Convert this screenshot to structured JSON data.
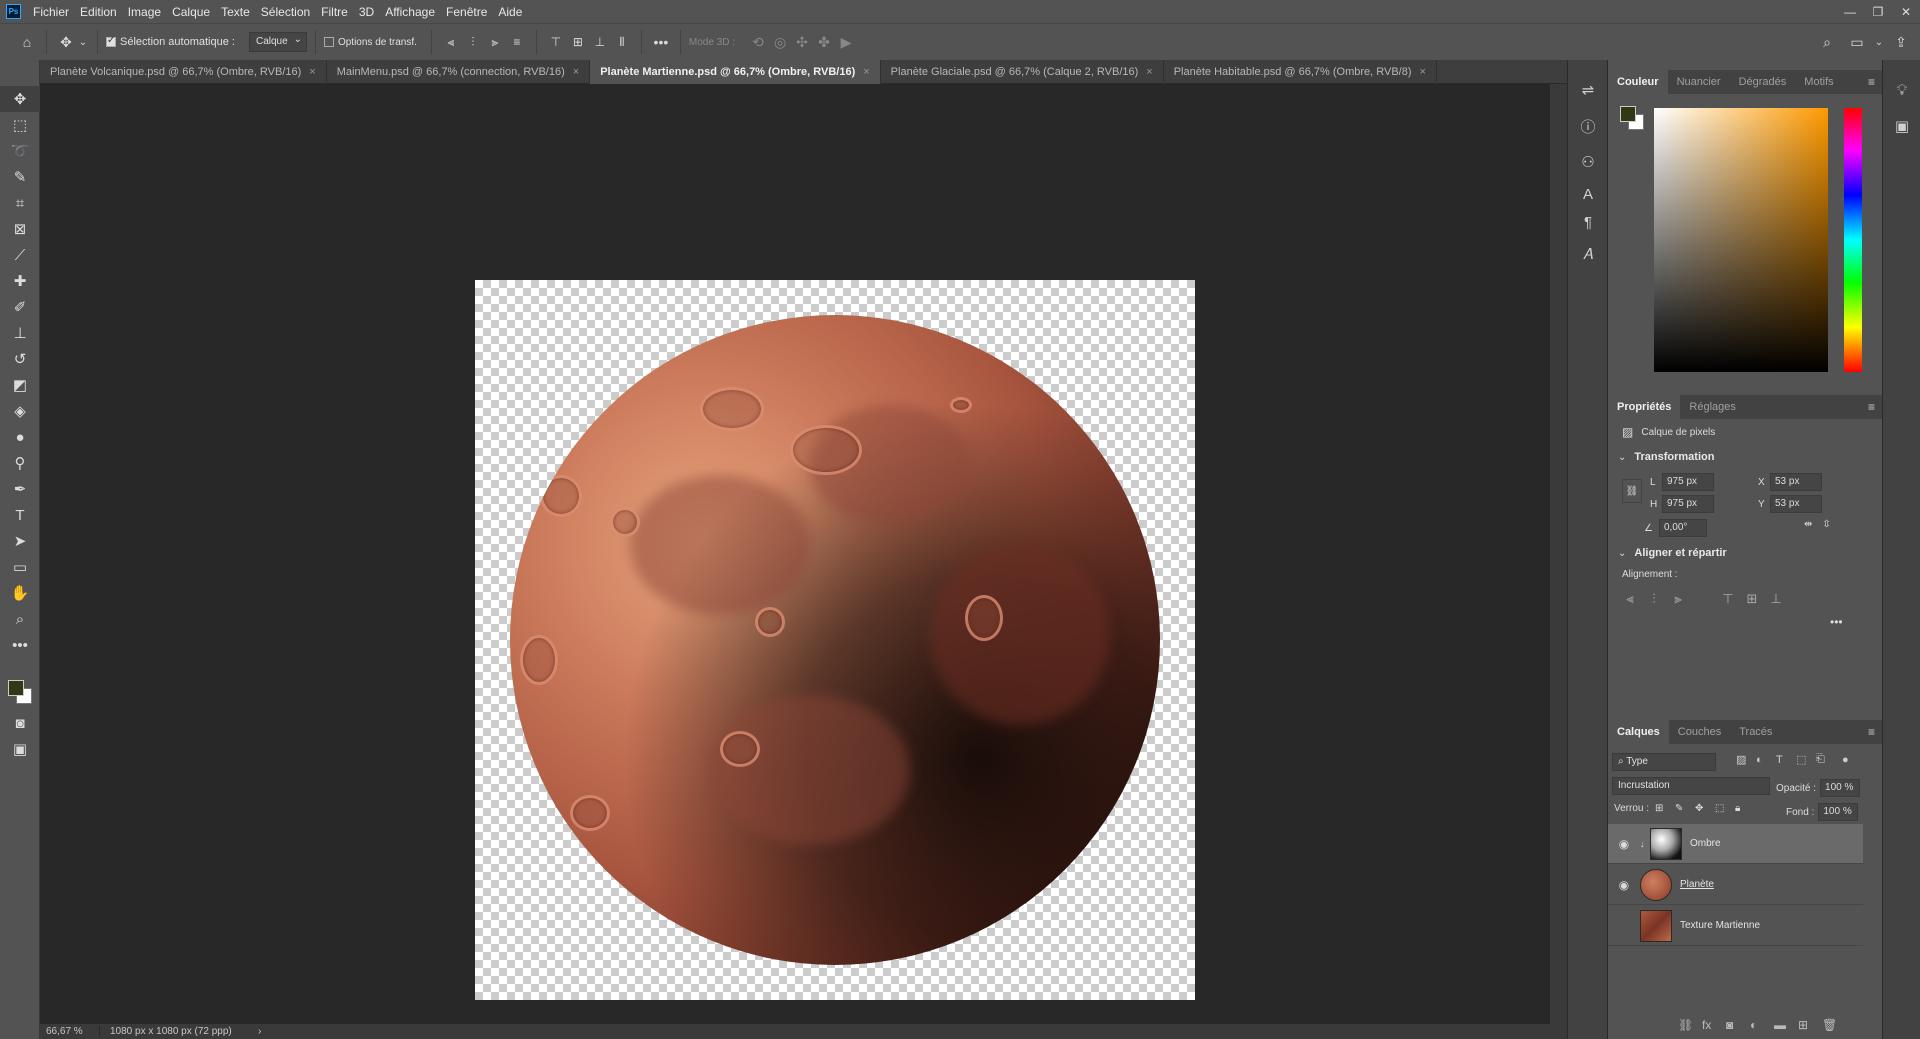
{
  "menu": [
    "Fichier",
    "Edition",
    "Image",
    "Calque",
    "Texte",
    "Sélection",
    "Filtre",
    "3D",
    "Affichage",
    "Fenêtre",
    "Aide"
  ],
  "app_logo": "Ps",
  "window_controls": [
    "—",
    "❐",
    "✕"
  ],
  "options": {
    "auto_select_label": "Sélection automatique :",
    "auto_select_value": "Calque",
    "transform_label": "Options de transf.",
    "mode3d_label": "Mode 3D :"
  },
  "tabs": [
    {
      "label": "Planète Volcanique.psd @ 66,7% (Ombre, RVB/16)",
      "active": false
    },
    {
      "label": "MainMenu.psd @ 66,7% (connection, RVB/16)",
      "active": false
    },
    {
      "label": "Planète Martienne.psd @ 66,7% (Ombre, RVB/16)",
      "active": true
    },
    {
      "label": "Planète Glaciale.psd @ 66,7% (Calque 2, RVB/16)",
      "active": false
    },
    {
      "label": "Planète Habitable.psd @ 66,7% (Ombre, RVB/8)",
      "active": false
    }
  ],
  "status": {
    "zoom": "66,67 %",
    "doc_info": "1080 px x 1080 px (72 ppp)",
    "arrow": "›"
  },
  "colors": {
    "foreground": "#2f3a12",
    "background": "#ffffff"
  },
  "color_panel": {
    "tabs": [
      "Couleur",
      "Nuancier",
      "Dégradés",
      "Motifs"
    ]
  },
  "properties": {
    "tabs": [
      "Propriétés",
      "Réglages"
    ],
    "layer_type": "Calque de pixels",
    "transform_title": "Transformation",
    "w_label": "L",
    "w_value": "975 px",
    "h_label": "H",
    "h_value": "975 px",
    "x_label": "X",
    "x_value": "53 px",
    "y_label": "Y",
    "y_value": "53 px",
    "angle_value": "0,00°",
    "align_title": "Aligner et répartir",
    "align_label": "Alignement :"
  },
  "layers": {
    "tabs": [
      "Calques",
      "Couches",
      "Tracés"
    ],
    "filter": "Type",
    "blend_mode": "Incrustation",
    "opacity_label": "Opacité :",
    "opacity_value": "100 %",
    "lock_label": "Verrou :",
    "fill_label": "Fond :",
    "fill_value": "100 %",
    "items": [
      {
        "name": "Ombre",
        "visible": true,
        "selected": true
      },
      {
        "name": "Planète",
        "visible": true,
        "selected": false
      },
      {
        "name": "Texture Martienne",
        "visible": false,
        "selected": false
      }
    ]
  }
}
